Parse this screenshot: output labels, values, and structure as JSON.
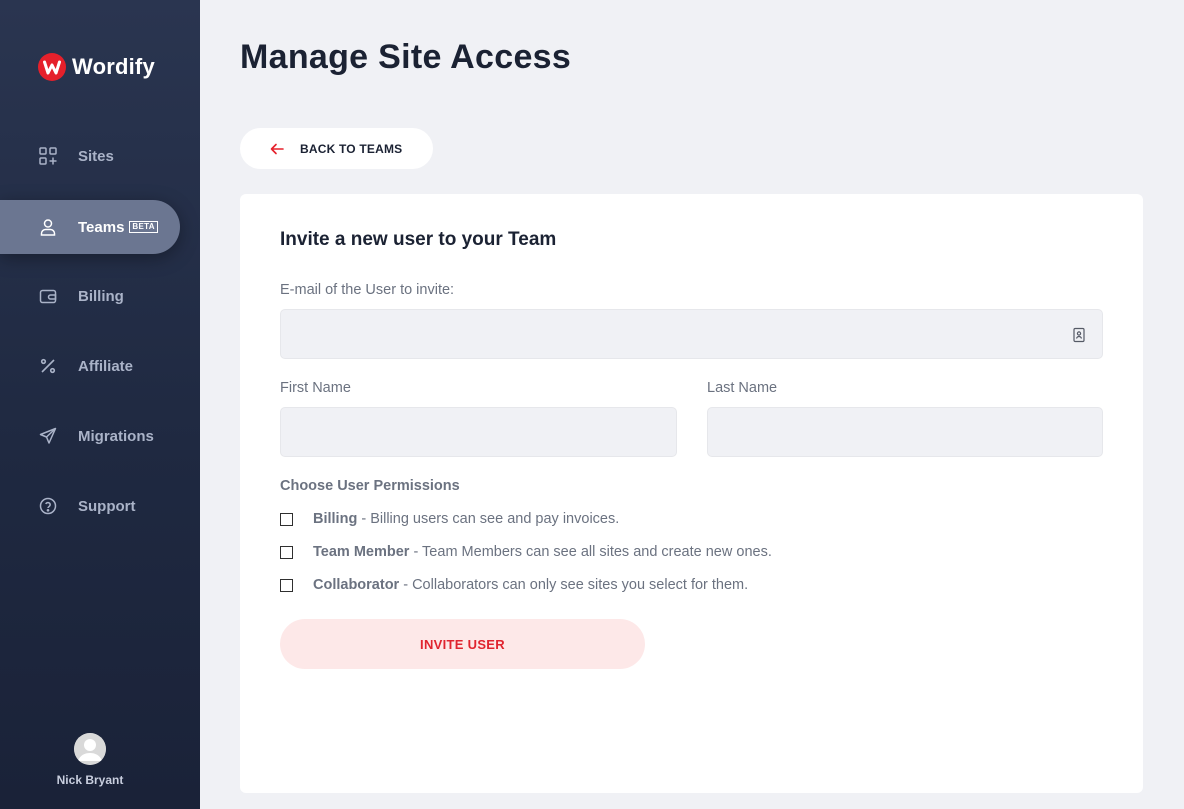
{
  "brand": {
    "name": "Wordify",
    "accent": "#e5202b",
    "sidebar_bg": "#1f2941"
  },
  "sidebar": {
    "items": [
      {
        "label": "Sites",
        "icon": "grid-plus-icon"
      },
      {
        "label": "Teams",
        "icon": "user-icon",
        "badge": "BETA",
        "active": true
      },
      {
        "label": "Billing",
        "icon": "wallet-icon"
      },
      {
        "label": "Affiliate",
        "icon": "percent-icon"
      },
      {
        "label": "Migrations",
        "icon": "paper-plane-icon"
      },
      {
        "label": "Support",
        "icon": "help-circle-icon"
      }
    ],
    "user": {
      "name": "Nick Bryant",
      "icon": "avatar-icon"
    }
  },
  "header": {
    "title": "Manage Site Access"
  },
  "back_button": {
    "label": "BACK TO TEAMS",
    "icon": "arrow-left-icon"
  },
  "form": {
    "title": "Invite a new user to your Team",
    "email": {
      "label": "E-mail of the User to invite:",
      "value": "",
      "icon": "contact-card-icon"
    },
    "first_name": {
      "label": "First Name",
      "value": ""
    },
    "last_name": {
      "label": "Last Name",
      "value": ""
    },
    "permissions": {
      "heading": "Choose User Permissions",
      "options": [
        {
          "name": "Billing",
          "description": " - Billing users can see and pay invoices.",
          "checked": false
        },
        {
          "name": "Team Member",
          "description": " - Team Members can see all sites and create new ones.",
          "checked": false
        },
        {
          "name": "Collaborator",
          "description": " - Collaborators can only see sites you select for them.",
          "checked": false
        }
      ]
    },
    "submit_label": "INVITE USER"
  }
}
